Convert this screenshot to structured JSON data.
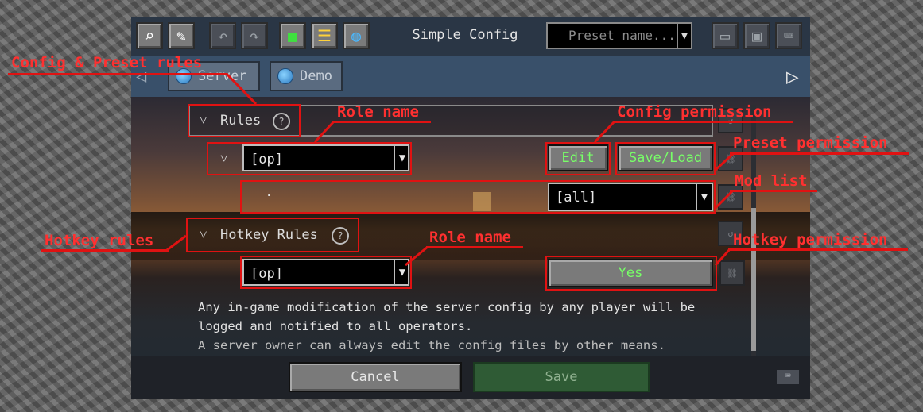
{
  "toolbar": {
    "title": "Simple Config",
    "preset_placeholder": "Preset name...",
    "icons": [
      "search-icon",
      "edit-icon",
      "undo-icon",
      "redo-icon",
      "cube-icon",
      "list-icon",
      "globe-icon",
      "folder-icon",
      "save-disk-icon",
      "keyboard-icon"
    ]
  },
  "tabs": [
    {
      "label": "Server"
    },
    {
      "label": "Demo"
    }
  ],
  "content": {
    "rules_section": "Rules",
    "role_value": "[op]",
    "edit_label": "Edit",
    "saveload_label": "Save/Load",
    "mod_list_value": "[all]",
    "mod_list_bullet": "·",
    "hotkey_section": "Hotkey Rules",
    "hotkey_role_value": "[op]",
    "hotkey_yes_label": "Yes",
    "note_line1": "Any in-game modification of the server config by any player will be",
    "note_line2": "logged and notified to all operators.",
    "note_line3": "A server owner can always edit the config files by other means."
  },
  "footer": {
    "cancel_label": "Cancel",
    "save_label": "Save"
  },
  "annotations": {
    "config_preset_rules": "Config & Preset rules",
    "role_name_1": "Role name",
    "config_permission": "Config permission",
    "preset_permission": "Preset permission",
    "mod_list": "Mod list",
    "hotkey_rules": "Hotkey rules",
    "role_name_2": "Role name",
    "hotkey_permission": "Hotkey permission"
  },
  "colors": {
    "annotation_red": "#e01212",
    "button_green_text": "#78ff68"
  }
}
